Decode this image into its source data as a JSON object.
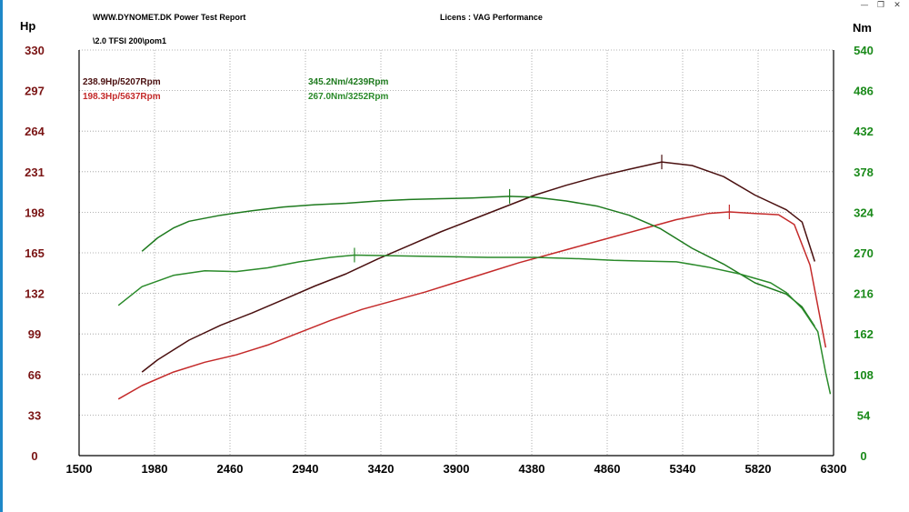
{
  "header": {
    "report_title": "WWW.DYNOMET.DK  Power Test Report",
    "licens": "Licens :  VAG Performance",
    "file_path": "\\2.0 TFSI 200\\pom1"
  },
  "window_controls": {
    "minimize": "—",
    "restore": "❐",
    "close": "✕"
  },
  "legend": {
    "hp_tuned": "238.9Hp/5207Rpm",
    "hp_stock": "198.3Hp/5637Rpm",
    "nm_tuned": "345.2Nm/4239Rpm",
    "nm_stock": "267.0Nm/3252Rpm"
  },
  "colors": {
    "hp_axis": "#7a1414",
    "nm_axis": "#1a8a1a",
    "hp_tuned": "#4a1010",
    "hp_stock": "#c42a2a",
    "nm_tuned": "#1e7a1e",
    "nm_stock": "#2a8a2a",
    "grid": "#9a9a9a"
  },
  "chart_data": {
    "type": "line",
    "xlabel": "",
    "ylabel_left": "Hp",
    "ylabel_right": "Nm",
    "xlim": [
      1500,
      6300
    ],
    "ylim_left": [
      0,
      330
    ],
    "ylim_right": [
      0,
      540
    ],
    "x_ticks": [
      1500,
      1980,
      2460,
      2940,
      3420,
      3900,
      4380,
      4860,
      5340,
      5820,
      6300
    ],
    "y_ticks_left": [
      0,
      33,
      66,
      99,
      132,
      165,
      198,
      231,
      264,
      297,
      330
    ],
    "y_ticks_right": [
      0,
      54,
      108,
      162,
      216,
      270,
      324,
      378,
      432,
      486,
      540
    ],
    "grid": true,
    "series": [
      {
        "key": "hp_tuned",
        "axis": "left",
        "peak": [
          5207,
          238.9
        ],
        "points": [
          [
            1900,
            68
          ],
          [
            2000,
            78
          ],
          [
            2200,
            94
          ],
          [
            2400,
            106
          ],
          [
            2600,
            116
          ],
          [
            2800,
            127
          ],
          [
            3000,
            138
          ],
          [
            3200,
            148
          ],
          [
            3400,
            160
          ],
          [
            3600,
            171
          ],
          [
            3800,
            182
          ],
          [
            4000,
            192
          ],
          [
            4200,
            202
          ],
          [
            4400,
            212
          ],
          [
            4600,
            220
          ],
          [
            4800,
            227
          ],
          [
            5000,
            233
          ],
          [
            5207,
            238.9
          ],
          [
            5400,
            236
          ],
          [
            5600,
            227
          ],
          [
            5800,
            212
          ],
          [
            6000,
            200
          ],
          [
            6100,
            190
          ],
          [
            6180,
            158
          ]
        ]
      },
      {
        "key": "hp_stock",
        "axis": "left",
        "peak": [
          5637,
          198.3
        ],
        "points": [
          [
            1750,
            46
          ],
          [
            1900,
            57
          ],
          [
            2100,
            68
          ],
          [
            2300,
            76
          ],
          [
            2500,
            82
          ],
          [
            2700,
            90
          ],
          [
            2900,
            100
          ],
          [
            3100,
            110
          ],
          [
            3300,
            119
          ],
          [
            3500,
            126
          ],
          [
            3700,
            133
          ],
          [
            3900,
            141
          ],
          [
            4100,
            149
          ],
          [
            4300,
            157
          ],
          [
            4500,
            164
          ],
          [
            4700,
            171
          ],
          [
            4900,
            178
          ],
          [
            5100,
            185
          ],
          [
            5300,
            192
          ],
          [
            5500,
            197
          ],
          [
            5637,
            198.3
          ],
          [
            5800,
            197
          ],
          [
            5950,
            196
          ],
          [
            6050,
            188
          ],
          [
            6150,
            155
          ],
          [
            6250,
            88
          ]
        ]
      },
      {
        "key": "nm_tuned",
        "axis": "right",
        "peak": [
          4239,
          345.2
        ],
        "points": [
          [
            1900,
            272
          ],
          [
            2000,
            290
          ],
          [
            2100,
            303
          ],
          [
            2200,
            312
          ],
          [
            2400,
            320
          ],
          [
            2600,
            326
          ],
          [
            2800,
            331
          ],
          [
            3000,
            334
          ],
          [
            3200,
            336
          ],
          [
            3400,
            339
          ],
          [
            3600,
            341
          ],
          [
            3800,
            342
          ],
          [
            4000,
            343
          ],
          [
            4239,
            345.2
          ],
          [
            4400,
            344
          ],
          [
            4600,
            339
          ],
          [
            4800,
            332
          ],
          [
            5000,
            320
          ],
          [
            5200,
            302
          ],
          [
            5400,
            276
          ],
          [
            5600,
            255
          ],
          [
            5800,
            230
          ],
          [
            6000,
            215
          ],
          [
            6100,
            198
          ],
          [
            6180,
            172
          ]
        ]
      },
      {
        "key": "nm_stock",
        "axis": "right",
        "peak": [
          3252,
          267.0
        ],
        "points": [
          [
            1750,
            200
          ],
          [
            1900,
            225
          ],
          [
            2100,
            240
          ],
          [
            2300,
            246
          ],
          [
            2500,
            245
          ],
          [
            2700,
            250
          ],
          [
            2900,
            258
          ],
          [
            3100,
            264
          ],
          [
            3252,
            267
          ],
          [
            3500,
            266
          ],
          [
            3800,
            265
          ],
          [
            4100,
            264
          ],
          [
            4400,
            264
          ],
          [
            4700,
            262
          ],
          [
            4900,
            260
          ],
          [
            5100,
            259
          ],
          [
            5300,
            258
          ],
          [
            5500,
            251
          ],
          [
            5700,
            242
          ],
          [
            5900,
            230
          ],
          [
            6000,
            217
          ],
          [
            6100,
            196
          ],
          [
            6200,
            165
          ],
          [
            6250,
            110
          ],
          [
            6280,
            82
          ]
        ]
      }
    ]
  }
}
